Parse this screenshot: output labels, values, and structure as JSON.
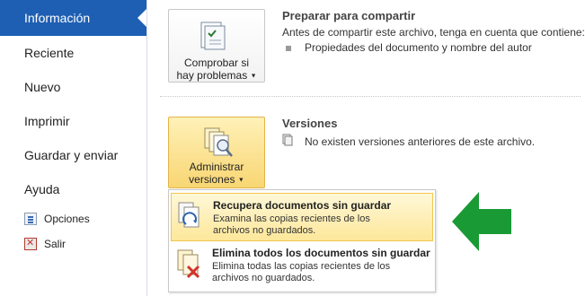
{
  "sidebar": {
    "selected": "Información",
    "items": [
      "Reciente",
      "Nuevo",
      "Imprimir",
      "Guardar y enviar",
      "Ayuda"
    ],
    "small_items": [
      "Opciones",
      "Salir"
    ]
  },
  "check_button": {
    "line1": "Comprobar si",
    "line2": "hay problemas"
  },
  "share_section": {
    "title": "Preparar para compartir",
    "description": "Antes de compartir este archivo, tenga en cuenta que contiene:",
    "bullet": "Propiedades del documento y nombre del autor"
  },
  "versions_button": {
    "line1": "Administrar",
    "line2": "versiones"
  },
  "versions_section": {
    "title": "Versiones",
    "text": "No existen versiones anteriores de este archivo."
  },
  "menu": {
    "items": [
      {
        "title": "Recupera documentos sin guardar",
        "desc1": "Examina las copias recientes de los",
        "desc2": "archivos no guardados."
      },
      {
        "title": "Elimina todos los documentos sin guardar",
        "desc1": "Elimina todas las copias recientes de los",
        "desc2": "archivos no guardados."
      }
    ]
  },
  "colors": {
    "accent": "#1e5fb3",
    "highlight": "#f8d673",
    "arrow": "#1a9a34"
  },
  "icons": {
    "check": "document-check-icon",
    "versions": "document-versions-icon",
    "options": "options-icon",
    "exit": "exit-icon",
    "recover": "recover-document-icon",
    "delete": "delete-document-icon",
    "arrow": "green-arrow-left-icon"
  }
}
